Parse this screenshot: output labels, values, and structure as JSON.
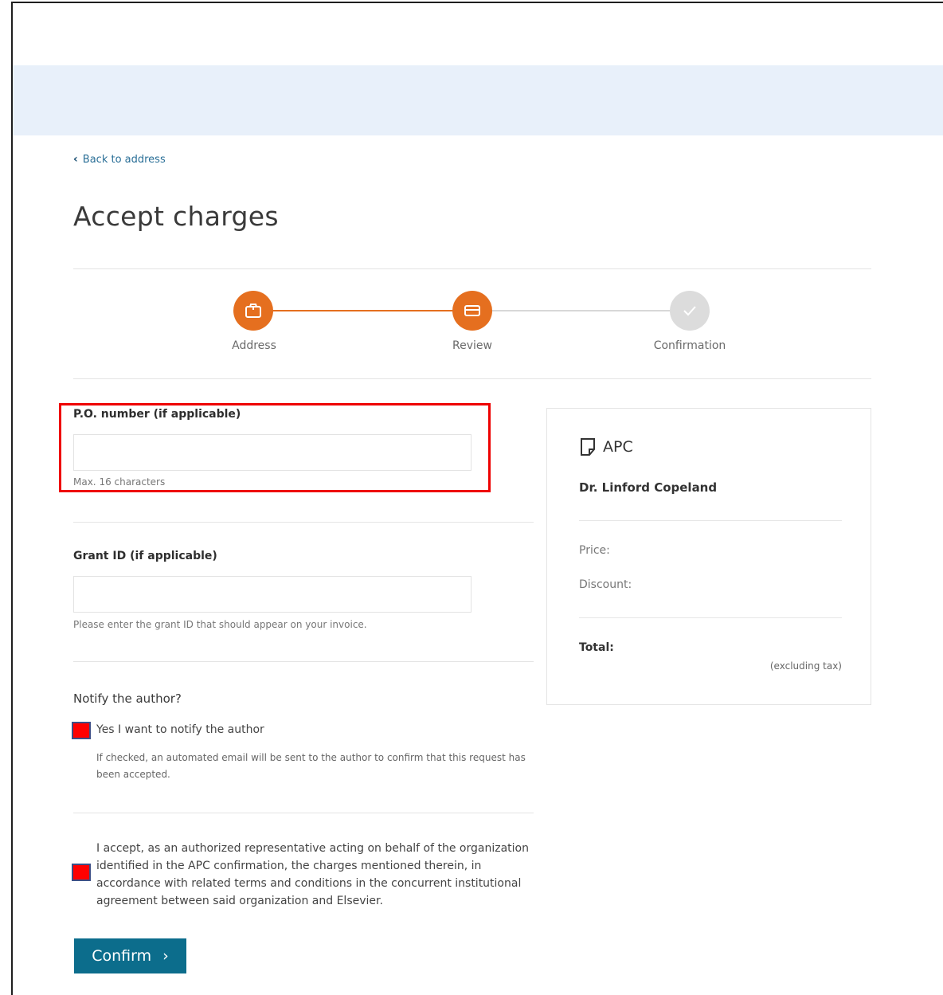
{
  "nav": {
    "back_label": "Back to address"
  },
  "page": {
    "title": "Accept charges"
  },
  "stepper": {
    "steps": [
      {
        "label": "Address",
        "state": "completed",
        "icon": "package-icon"
      },
      {
        "label": "Review",
        "state": "current",
        "icon": "card-icon"
      },
      {
        "label": "Confirmation",
        "state": "pending",
        "icon": "check-icon"
      }
    ],
    "active_color": "#e56f1f",
    "inactive_color": "#dcdcdc"
  },
  "form": {
    "po": {
      "label": "P.O. number (if applicable)",
      "value": "",
      "hint": "Max. 16 characters"
    },
    "grant": {
      "label": "Grant ID (if applicable)",
      "value": "",
      "hint": "Please enter the grant ID that should appear on your invoice."
    },
    "notify": {
      "question": "Notify the author?",
      "checkbox_label": "Yes I want to notify the author",
      "description": "If checked, an automated email will be sent to the author to confirm that this request has been accepted."
    },
    "accept": {
      "text": "I accept, as an authorized representative acting on behalf of the organization identified in the APC confirmation, the charges mentioned therein, in accordance with related terms and conditions in the concurrent institutional agreement between said organization and Elsevier."
    },
    "confirm_label": "Confirm",
    "confirm_color": "#0c6d8c",
    "highlight_color": "#ee0000"
  },
  "summary": {
    "title": "APC",
    "name": "Dr. Linford Copeland",
    "price_label": "Price:",
    "discount_label": "Discount:",
    "total_label": "Total:",
    "tax_note": "(excluding tax)"
  }
}
